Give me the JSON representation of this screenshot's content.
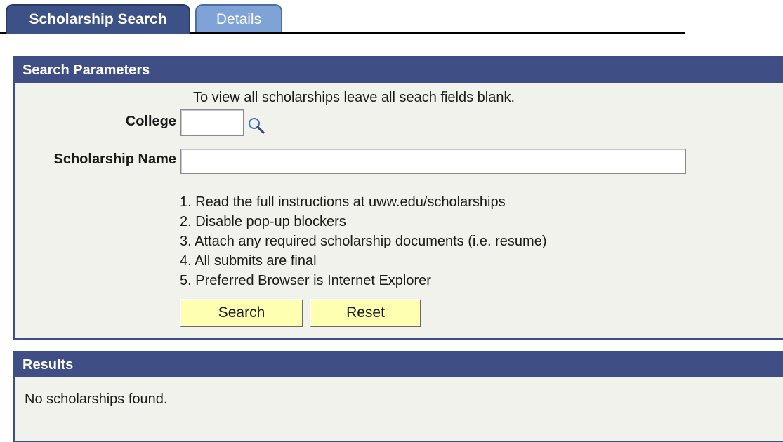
{
  "tabs": [
    {
      "label": "Scholarship Search",
      "active": true
    },
    {
      "label": "Details",
      "active": false
    }
  ],
  "search_parameters": {
    "header": "Search Parameters",
    "note": "To view all scholarships leave all seach fields blank.",
    "college": {
      "label": "College",
      "value": "",
      "lookup_icon": "magnifier-lookup-icon"
    },
    "scholarship_name": {
      "label": "Scholarship Name",
      "value": ""
    },
    "instructions": [
      "1. Read the full instructions at uww.edu/scholarships",
      "2. Disable pop-up blockers",
      "3. Attach any required scholarship documents (i.e. resume)",
      "4. All submits are final",
      "5. Preferred Browser is Internet Explorer"
    ],
    "buttons": {
      "search": "Search",
      "reset": "Reset"
    }
  },
  "results": {
    "header": "Results",
    "message": "No scholarships found."
  },
  "colors": {
    "header_bg": "#3f4f86",
    "tab_active_bg": "#3c5186",
    "tab_inactive_bg": "#7fa3d6",
    "panel_bg": "#f2f2ed",
    "button_bg": "#ffffb2"
  }
}
